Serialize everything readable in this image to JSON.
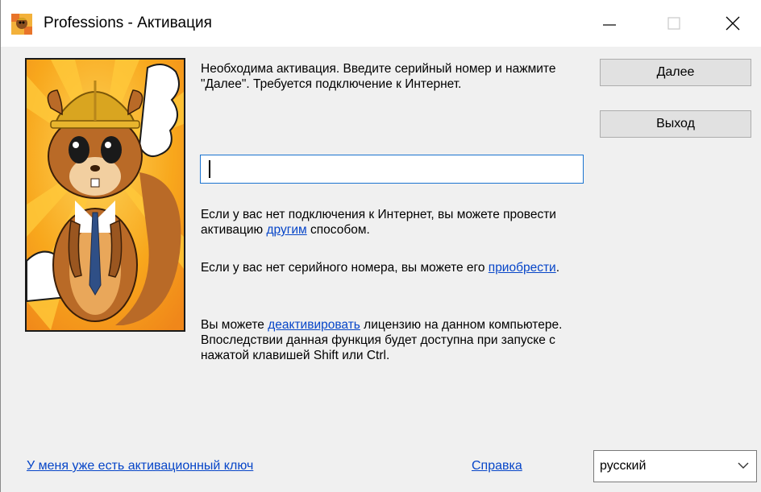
{
  "window": {
    "title": "Professions - Активация",
    "icon": "squirrel-app-icon"
  },
  "content": {
    "intro_text": "Необходима активация. Введите серийный номер и нажмите \"Далее\". Требуется подключение к Интернет.",
    "serial_input": {
      "value": "",
      "placeholder": ""
    },
    "no_internet": {
      "before": "Если у вас нет подключения к Интернет, вы можете провести активацию ",
      "link": "другим",
      "after": " способом."
    },
    "no_serial": {
      "before": "Если у вас нет серийного номера, вы можете его ",
      "link": "приобрести",
      "after": "."
    },
    "deactivate": {
      "before": "Вы можете ",
      "link": "деактивировать",
      "after": " лицензию на данном компьютере. Впоследствии данная функция будет доступна при запуске с нажатой клавишей Shift или Ctrl."
    }
  },
  "buttons": {
    "next_label": "Далее",
    "exit_label": "Выход"
  },
  "footer": {
    "have_key_link": "У меня уже есть активационный ключ",
    "help_link": "Справка",
    "language_selected": "русский"
  },
  "colors": {
    "link": "#0645c8",
    "input_border": "#1a73d0",
    "button_bg": "#e1e1e1",
    "window_bg": "#f0f0f0"
  }
}
